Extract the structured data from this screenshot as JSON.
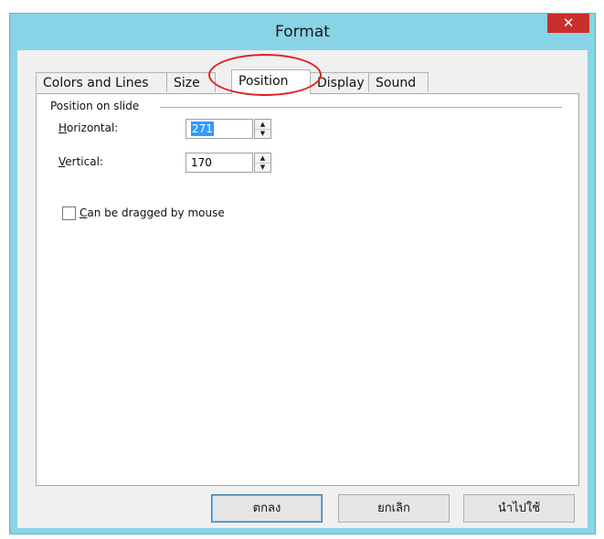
{
  "window": {
    "title": "Format",
    "close_symbol": "✕"
  },
  "tabs": [
    {
      "label": "Colors and Lines",
      "active": false
    },
    {
      "label": "Size",
      "active": false
    },
    {
      "label": "Position",
      "active": true
    },
    {
      "label": "Display",
      "active": false
    },
    {
      "label": "Sound",
      "active": false
    }
  ],
  "position_group": {
    "label": "Position on slide",
    "horizontal": {
      "mnemonic": "H",
      "label_rest": "orizontal:",
      "value": "271"
    },
    "vertical": {
      "mnemonic": "V",
      "label_rest": "ertical:",
      "value": "170"
    },
    "drag_checkbox": {
      "mnemonic": "C",
      "label_rest": "an be dragged by mouse",
      "checked": false
    }
  },
  "buttons": {
    "ok": "ตกลง",
    "cancel": "ยกเลิก",
    "apply": "นำไปใช้"
  },
  "colors": {
    "titlebar": "#89d3e6",
    "close_button": "#c7302b",
    "annotation": "#e02020",
    "selection": "#3399ff"
  },
  "icons": {
    "close": "close-icon",
    "spin_up": "spin-up-arrow-icon",
    "spin_down": "spin-down-arrow-icon"
  }
}
